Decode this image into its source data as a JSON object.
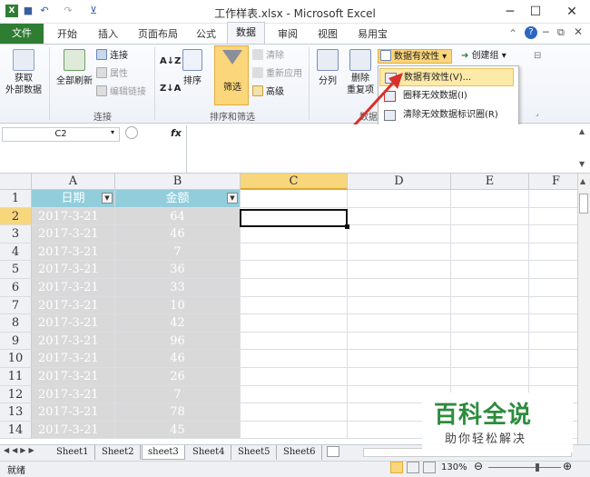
{
  "window": {
    "title": "工作样表.xlsx - Microsoft Excel"
  },
  "ribbon_tabs": [
    "文件",
    "开始",
    "插入",
    "页面布局",
    "公式",
    "数据",
    "审阅",
    "视图",
    "易用宝"
  ],
  "ribbon": {
    "get_external": "获取\n外部数据",
    "refresh_all": "全部刷新",
    "connections": "连接",
    "properties": "属性",
    "edit_links": "编辑链接",
    "group_connections": "连接",
    "sort": "排序",
    "filter": "筛选",
    "clear": "清除",
    "reapply": "重新应用",
    "advanced": "高级",
    "group_sort_filter": "排序和筛选",
    "split": "分列",
    "remove": "删除\n重复项",
    "group_data_tools": "数据",
    "data_validation": "数据有效性",
    "group_btn": "创建组"
  },
  "dropdown_menu": [
    "数据有效性(V)...",
    "圈释无效数据(I)",
    "清除无效数据标识圈(R)"
  ],
  "formula_bar": {
    "name_box": "C2",
    "fx": "fx",
    "value": ""
  },
  "columns": [
    "A",
    "B",
    "C",
    "D",
    "E",
    "F"
  ],
  "headers": {
    "a": "日期",
    "b": "金额"
  },
  "rows": [
    {
      "n": "1"
    },
    {
      "n": "2",
      "date": "2017-3-21",
      "amt": "64"
    },
    {
      "n": "3",
      "date": "2017-3-21",
      "amt": "46"
    },
    {
      "n": "4",
      "date": "2017-3-21",
      "amt": "7"
    },
    {
      "n": "5",
      "date": "2017-3-21",
      "amt": "36"
    },
    {
      "n": "6",
      "date": "2017-3-21",
      "amt": "33"
    },
    {
      "n": "7",
      "date": "2017-3-21",
      "amt": "10"
    },
    {
      "n": "8",
      "date": "2017-3-21",
      "amt": "42"
    },
    {
      "n": "9",
      "date": "2017-3-21",
      "amt": "96"
    },
    {
      "n": "10",
      "date": "2017-3-21",
      "amt": "46"
    },
    {
      "n": "11",
      "date": "2017-3-21",
      "amt": "26"
    },
    {
      "n": "12",
      "date": "2017-3-21",
      "amt": "7"
    },
    {
      "n": "13",
      "date": "2017-3-21",
      "amt": "78"
    },
    {
      "n": "14",
      "date": "2017-3-21",
      "amt": "45"
    }
  ],
  "sheets": [
    "Sheet1",
    "Sheet2",
    "sheet3",
    "Sheet4",
    "Sheet5",
    "Sheet6"
  ],
  "active_sheet": "sheet3",
  "status": {
    "ready": "就绪",
    "zoom": "130%"
  },
  "watermark": {
    "line1": "百科全说",
    "line2": "助你轻松解决"
  },
  "colors": {
    "file_tab": "#2f7d32",
    "header_fill": "#92cddc",
    "data_fill": "#d9d9d9",
    "selected_header": "#f7d67c",
    "menu_highlight": "#fde9a8",
    "arrow": "#d9302a"
  }
}
